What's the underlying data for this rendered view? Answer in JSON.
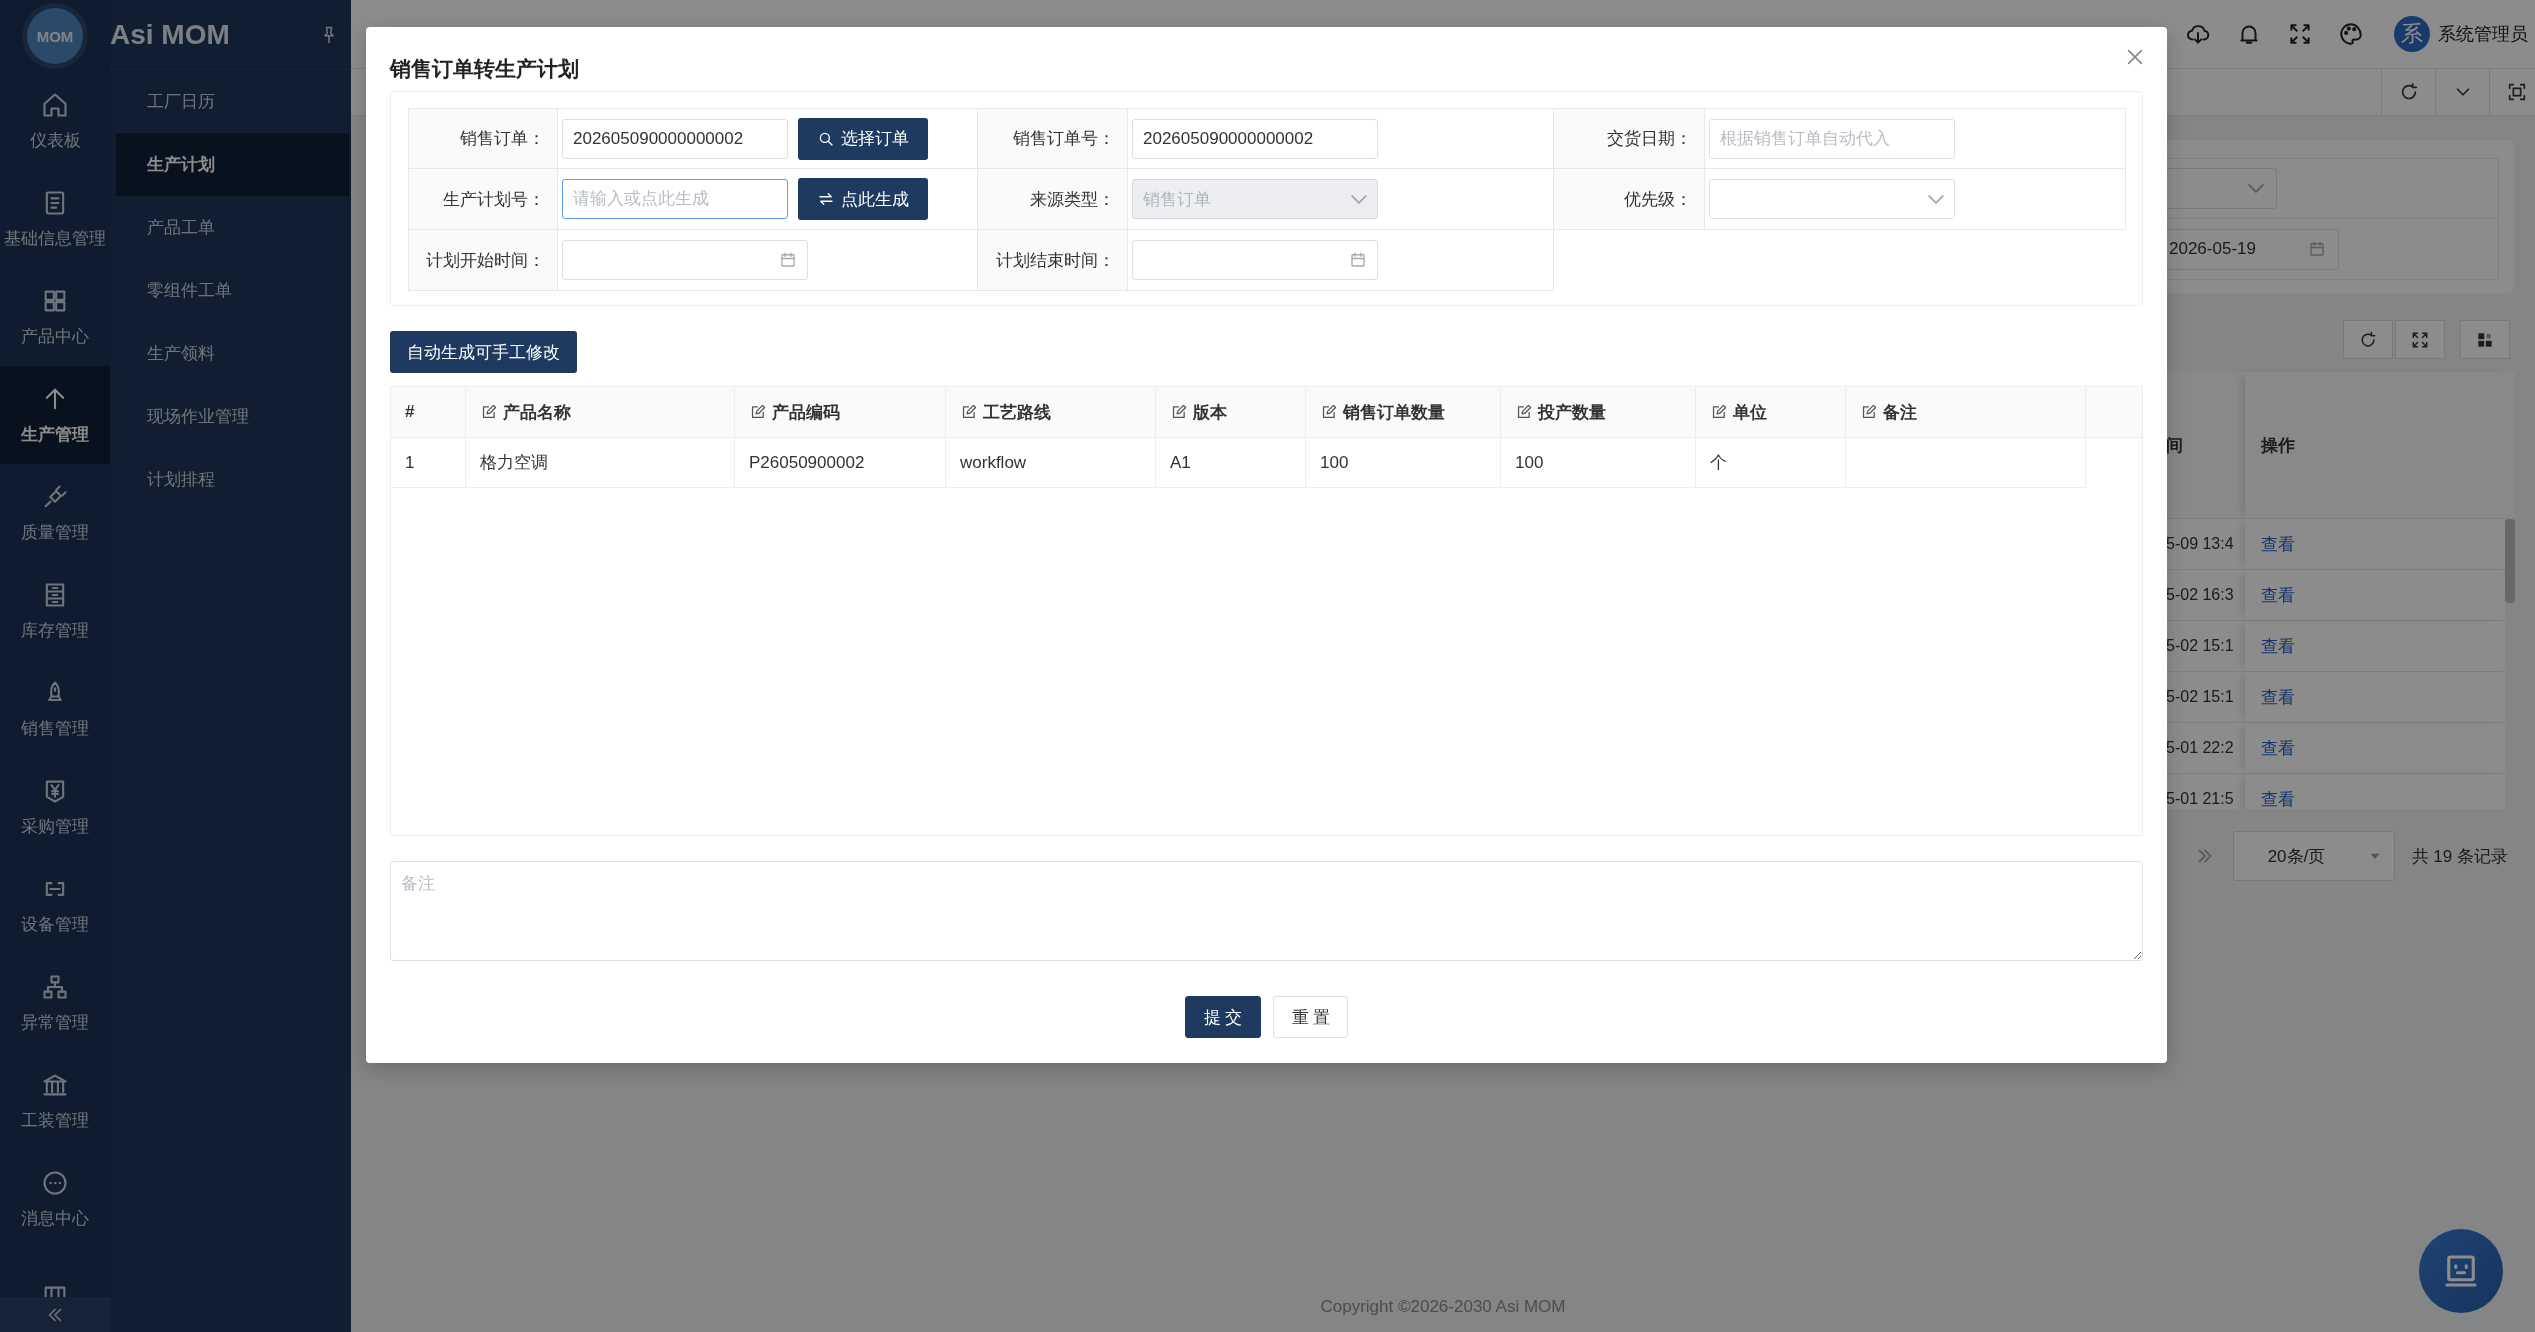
{
  "sidebar": {
    "logo": "MOM",
    "app_name": "Asi MOM",
    "menu": [
      {
        "label": "仪表板",
        "selected": false
      },
      {
        "label": "基础信息管理",
        "selected": false
      },
      {
        "label": "产品中心",
        "selected": false
      },
      {
        "label": "生产管理",
        "selected": true
      },
      {
        "label": "质量管理",
        "selected": false
      },
      {
        "label": "库存管理",
        "selected": false
      },
      {
        "label": "销售管理",
        "selected": false
      },
      {
        "label": "采购管理",
        "selected": false
      },
      {
        "label": "设备管理",
        "selected": false
      },
      {
        "label": "异常管理",
        "selected": false
      },
      {
        "label": "工装管理",
        "selected": false
      },
      {
        "label": "消息中心",
        "selected": false
      },
      {
        "selected": false
      }
    ],
    "submenu": [
      {
        "label": "工厂日历",
        "selected": false
      },
      {
        "label": "生产计划",
        "selected": true
      },
      {
        "label": "产品工单",
        "selected": false
      },
      {
        "label": "零组件工单",
        "selected": false
      },
      {
        "label": "生产领料",
        "selected": false
      },
      {
        "label": "现场作业管理",
        "selected": false
      },
      {
        "label": "计划排程",
        "selected": false
      }
    ]
  },
  "header": {
    "avatar": "系",
    "user_name": "系统管理员"
  },
  "page": {
    "filter_date": "2026-05-19",
    "table": {
      "columns": [
        {
          "label": "间"
        },
        {
          "label": "操作"
        }
      ],
      "rows": [
        {
          "time": "5-09 13:4",
          "action": "查看"
        },
        {
          "time": "5-02 16:3",
          "action": "查看"
        },
        {
          "time": "5-02 15:1",
          "action": "查看"
        },
        {
          "time": "5-02 15:1",
          "action": "查看"
        },
        {
          "time": "5-01 22:2",
          "action": "查看"
        },
        {
          "time": "5-01 21:5",
          "action": "查看"
        }
      ]
    },
    "pagination": {
      "page_size": "20条/页",
      "total": "共 19 条记录"
    }
  },
  "footer": "Copyright ©2026-2030 Asi MOM",
  "dialog": {
    "title": "销售订单转生产计划",
    "form": {
      "rows": [
        {
          "fields": [
            {
              "label": "销售订单：",
              "kind": "input",
              "value": "202605090000000002",
              "focused": false,
              "disabled": false,
              "action": {
                "label": "选择订单",
                "kind": "search"
              }
            },
            {
              "label": "销售订单号：",
              "kind": "input",
              "value": "202605090000000002",
              "focused": false,
              "disabled": false
            },
            {
              "label": "交货日期：",
              "kind": "input",
              "placeholder": "根据销售订单自动代入",
              "focused": false,
              "disabled": false
            }
          ]
        },
        {
          "fields": [
            {
              "label": "生产计划号：",
              "kind": "input",
              "placeholder": "请输入或点此生成",
              "focused": true,
              "disabled": false,
              "action": {
                "label": "点此生成",
                "kind": "generate"
              }
            },
            {
              "label": "来源类型：",
              "kind": "select",
              "value": "销售订单",
              "focused": false,
              "disabled": true
            },
            {
              "label": "优先级：",
              "kind": "select",
              "focused": false,
              "disabled": false
            }
          ]
        },
        {
          "fields": [
            {
              "label": "计划开始时间：",
              "kind": "date",
              "focused": false,
              "disabled": false
            },
            {
              "label": "计划结束时间：",
              "kind": "date",
              "focused": false,
              "disabled": false
            }
          ]
        }
      ]
    },
    "generate_button": "自动生成可手工修改",
    "table": {
      "columns": [
        {
          "label": "#",
          "editable": false
        },
        {
          "label": "产品名称",
          "editable": true
        },
        {
          "label": "产品编码",
          "editable": true
        },
        {
          "label": "工艺路线",
          "editable": true
        },
        {
          "label": "版本",
          "editable": true
        },
        {
          "label": "销售订单数量",
          "editable": true
        },
        {
          "label": "投产数量",
          "editable": true
        },
        {
          "label": "单位",
          "editable": true
        },
        {
          "label": "备注",
          "editable": true
        }
      ],
      "rows": [
        {
          "cells": [
            "1",
            "格力空调",
            "P26050900002",
            "workflow",
            "A1",
            "100",
            "100",
            "个"
          ]
        }
      ]
    },
    "remark": {
      "placeholder": "备注"
    },
    "buttons": [
      {
        "label": "提交",
        "kind": "primary"
      },
      {
        "label": "重置",
        "kind": "default"
      }
    ]
  }
}
